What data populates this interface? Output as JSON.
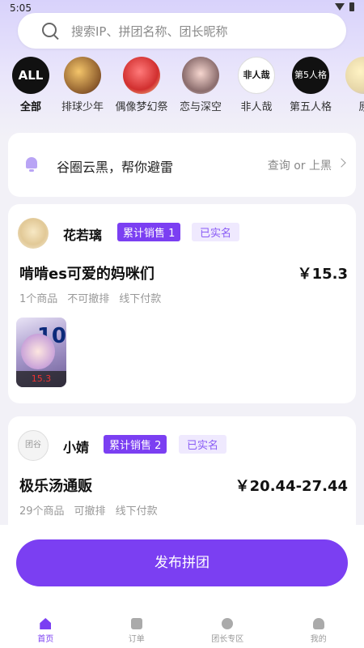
{
  "status": {
    "time": "5:05"
  },
  "search": {
    "placeholder": "搜索IP、拼团名称、团长昵称"
  },
  "categories": [
    {
      "label": "全部",
      "icon_text": "ALL"
    },
    {
      "label": "排球少年"
    },
    {
      "label": "偶像梦幻祭"
    },
    {
      "label": "恋与深空"
    },
    {
      "label": "非人哉",
      "icon_text": "非人哉"
    },
    {
      "label": "第五人格",
      "icon_text": "第5人格"
    },
    {
      "label": "原"
    }
  ],
  "notice": {
    "text": "谷圈云黑，帮你避雷",
    "link": "查询 or 上黑"
  },
  "sellers": [
    {
      "name": "花若璃",
      "sales_badge": "累计销售 1",
      "verified": "已实名",
      "group_title": "啃啃es可爱的妈咪们",
      "price": "￥15.3",
      "meta": [
        "1个商品",
        "不可撤排",
        "线下付款"
      ],
      "thumb_price": "15.3",
      "thumb_number": "10"
    },
    {
      "name": "小婧",
      "avatar_text": "团谷",
      "sales_badge": "累计销售 2",
      "verified": "已实名",
      "group_title": "极乐汤通贩",
      "price": "￥20.44-27.44",
      "meta": [
        "29个商品",
        "可撤排",
        "线下付款"
      ]
    }
  ],
  "publish_button": "发布拼团",
  "tabs": [
    {
      "label": "首页",
      "icon": "home-icon",
      "active": true
    },
    {
      "label": "订单",
      "icon": "order-icon"
    },
    {
      "label": "团长专区",
      "icon": "star-icon"
    },
    {
      "label": "我的",
      "icon": "user-icon"
    }
  ],
  "colors": {
    "accent": "#7b3ff2",
    "verified_bg": "#efe9fe"
  }
}
